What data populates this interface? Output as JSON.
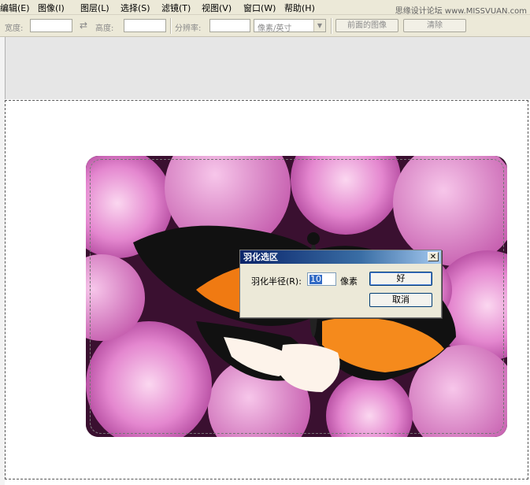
{
  "menu": {
    "items": [
      "编辑(E)",
      "图像(I)",
      "图层(L)",
      "选择(S)",
      "滤镜(T)",
      "视图(V)",
      "窗口(W)",
      "帮助(H)"
    ]
  },
  "watermark": "思缘设计论坛 www.MISSVUAN.com",
  "options_bar": {
    "width_label": "宽度:",
    "width_value": "",
    "height_label": "高度:",
    "height_value": "",
    "resolution_label": "分辨率:",
    "resolution_value": "",
    "unit_select": "像素/英寸",
    "front_image_button": "前面的图像",
    "clear_button": "清除"
  },
  "dialog": {
    "title": "羽化选区",
    "radius_label": "羽化半径(R):",
    "radius_value": "10",
    "unit": "像素",
    "ok_button": "好",
    "cancel_button": "取消",
    "close_icon": "close-icon"
  },
  "colors": {
    "title_bar_start": "#0a246a",
    "title_bar_end": "#a6caf0",
    "dialog_bg": "#ece9d8",
    "selection_highlight": "#316ac5"
  }
}
